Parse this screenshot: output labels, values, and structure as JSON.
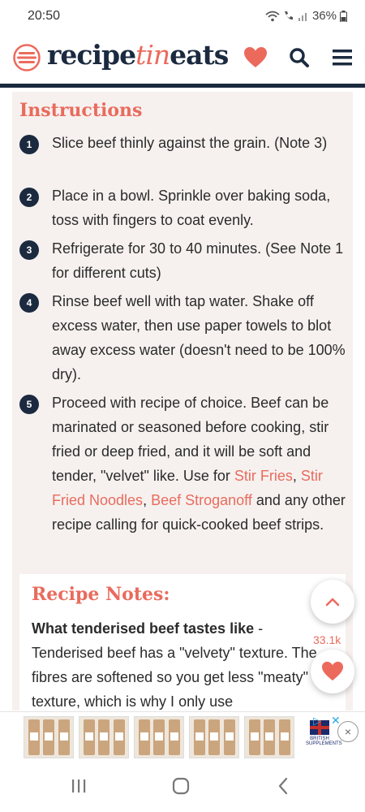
{
  "status_bar": {
    "time": "20:50",
    "battery": "36%"
  },
  "header": {
    "logo_part1": "recipe",
    "logo_part2": "tin",
    "logo_part3": "eats",
    "brand_color": "#ec6a5c",
    "navy": "#1b2a3f"
  },
  "instructions": {
    "title": "Instructions",
    "steps": [
      {
        "num": "1",
        "text": "Slice beef thinly against the grain. (Note 3)"
      },
      {
        "num": "2",
        "text": "Place in a bowl. Sprinkle over baking soda, toss with fingers to coat evenly."
      },
      {
        "num": "3",
        "text": "Refrigerate for 30 to 40 minutes. (See Note 1 for different cuts)"
      },
      {
        "num": "4",
        "text": "Rinse beef well with tap water. Shake off excess water, then use paper towels to blot away excess water (doesn't need to be 100% dry)."
      },
      {
        "num": "5",
        "text_a": "Proceed with recipe of choice. Beef can be marinated or seasoned before cooking, stir fried or deep fried, and it will be soft and tender, \"velvet\" like. Use for ",
        "link1": "Stir Fries",
        "sep1": ", ",
        "link2": "Stir Fried Noodles",
        "sep2": ", ",
        "link3": "Beef Stroganoff",
        "text_b": " and any other recipe calling for quick-cooked beef strips."
      }
    ]
  },
  "notes": {
    "title": "Recipe Notes:",
    "bold_lead": "What tenderised beef tastes like",
    "text": " - Tenderised beef has a \"velvety\" texture. The fibres are softened so you get less \"meaty\" texture, which is why I only use"
  },
  "floating": {
    "save_count": "33.1k"
  },
  "ad": {
    "brand_line1": "BRITISH",
    "brand_line2": "SUPPLEMENTS",
    "close_symbol": "×",
    "choices_symbol": "▷",
    "x_symbol": "✕"
  },
  "icons": {
    "heart": "heart-icon",
    "search": "search-icon",
    "menu": "hamburger-menu-icon",
    "up": "chevron-up-icon",
    "recents": "recents-icon",
    "home": "home-icon",
    "back": "back-icon"
  }
}
